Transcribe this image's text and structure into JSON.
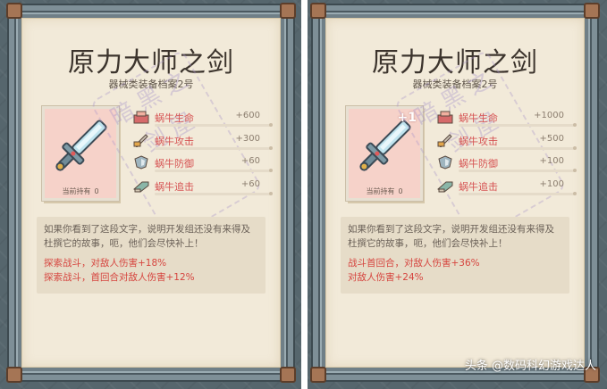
{
  "panels": [
    {
      "title": "原力大师之剑",
      "subtitle": "器械类装备档案2号",
      "card": {
        "plus": "",
        "held_label": "当前持有",
        "held_count": "0"
      },
      "stats": [
        {
          "icon": "health-icon",
          "name": "蜗牛生命",
          "value": "+600"
        },
        {
          "icon": "attack-icon",
          "name": "蜗牛攻击",
          "value": "+300"
        },
        {
          "icon": "defense-icon",
          "name": "蜗牛防御",
          "value": "+60"
        },
        {
          "icon": "pursuit-icon",
          "name": "蜗牛追击",
          "value": "+60"
        }
      ],
      "description": "如果你看到了这段文字，说明开发组还没有来得及杜撰它的故事，呃，他们会尽快补上！",
      "effects": [
        "探索战斗，对敌人伤害+18%",
        "探索战斗，首回合对敌人伤害+12%"
      ],
      "watermark": "暗 黑 之 剑 屋"
    },
    {
      "title": "原力大师之剑",
      "subtitle": "器械类装备档案2号",
      "card": {
        "plus": "+1",
        "held_label": "当前持有",
        "held_count": "0"
      },
      "stats": [
        {
          "icon": "health-icon",
          "name": "蜗牛生命",
          "value": "+1000"
        },
        {
          "icon": "attack-icon",
          "name": "蜗牛攻击",
          "value": "+500"
        },
        {
          "icon": "defense-icon",
          "name": "蜗牛防御",
          "value": "+100"
        },
        {
          "icon": "pursuit-icon",
          "name": "蜗牛追击",
          "value": "+100"
        }
      ],
      "description": "如果你看到了这段文字，说明开发组还没有来得及杜撰它的故事，呃，他们会尽快补上！",
      "effects": [
        "战斗首回合，对敌人伤害+36%",
        "对敌人伤害+24%"
      ],
      "watermark": "暗 黑 之 剑 屋"
    }
  ],
  "credit": "头条 @数码科幻游戏达人",
  "colors": {
    "stat_name": "#d65353",
    "effect": "#d6453f",
    "paper": "#f2ead9",
    "card": "#f6d2c9"
  }
}
